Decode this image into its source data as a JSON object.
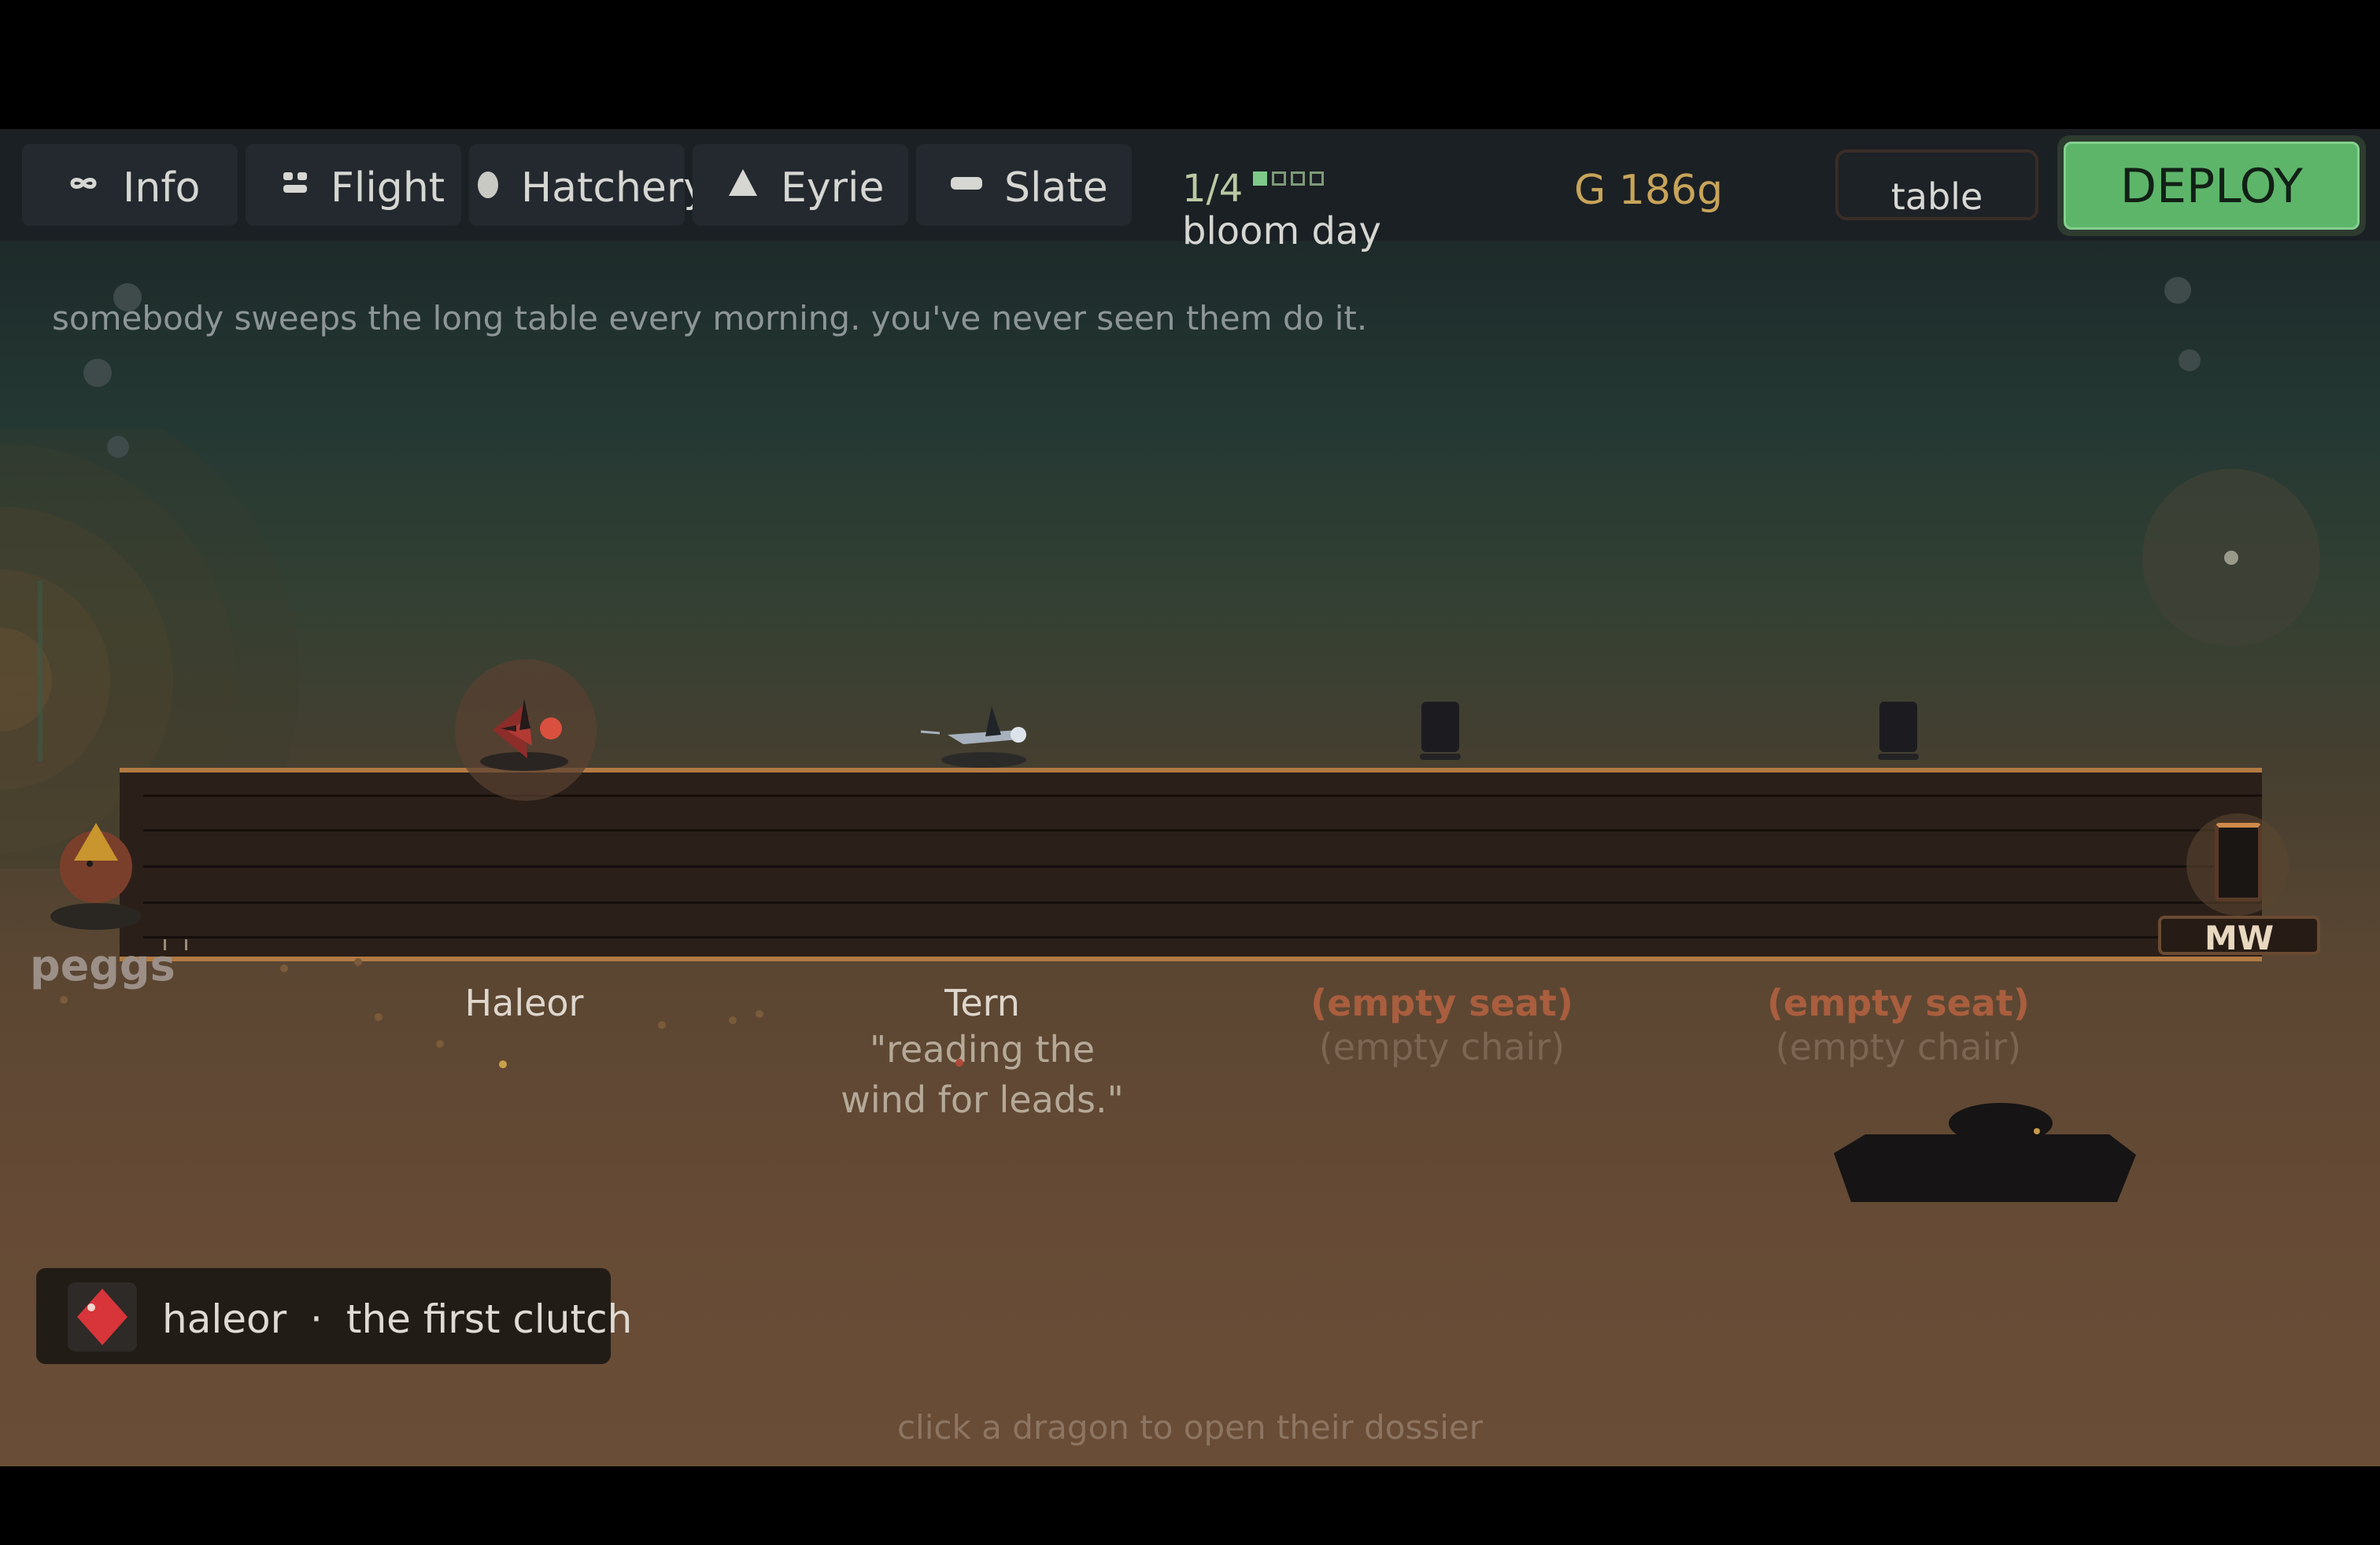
{
  "tabs": [
    {
      "label": "Info",
      "icon": "infinity-icon"
    },
    {
      "label": "Flight",
      "icon": "flight-icon"
    },
    {
      "label": "Hatchery",
      "icon": "egg-icon"
    },
    {
      "label": "Eyrie",
      "icon": "mountain-icon"
    },
    {
      "label": "Slate",
      "icon": "slate-icon"
    }
  ],
  "day": {
    "count": "1/4",
    "pips_filled": 1,
    "pips_total": 4,
    "name": "bloom day"
  },
  "gold": "G 186g",
  "table_button": "table",
  "deploy_button": "DEPLOY",
  "flavor_text": "somebody sweeps the long table every morning. you've never seen them do it.",
  "host": {
    "name": "peggs"
  },
  "seats": [
    {
      "name": "Haleor",
      "quote": ""
    },
    {
      "name": "Tern",
      "quote_line1": "\"reading the",
      "quote_line2": "wind for leads.\""
    },
    {
      "name": "(empty seat)",
      "sub": "(empty chair)"
    },
    {
      "name": "(empty seat)",
      "sub": "(empty chair)"
    }
  ],
  "end_seat_label": "MW",
  "toast": {
    "name": "haleor",
    "separator": "·",
    "text": "the first clutch"
  },
  "hint": "click a dragon to open their dossier",
  "colors": {
    "deploy": "#5db56a",
    "gold": "#c7a45a",
    "table_edge": "#b27a43",
    "empty_seat": "#a95e3e"
  }
}
